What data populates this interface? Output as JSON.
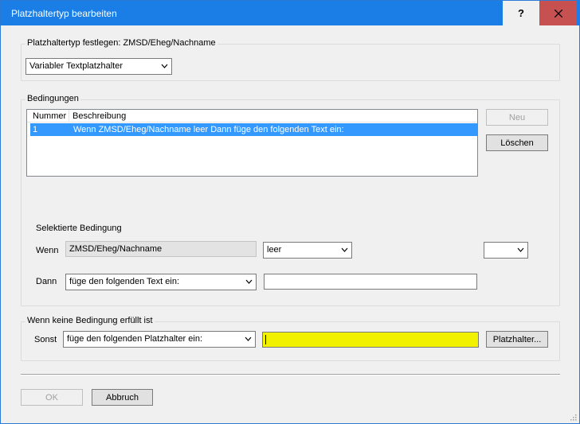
{
  "window": {
    "title": "Platzhaltertyp bearbeiten",
    "help_label": "?"
  },
  "type_group": {
    "label": "Platzhaltertyp festlegen: ZMSD/Eheg/Nachname",
    "type_select": "Variabler Textplatzhalter"
  },
  "conditions_group": {
    "label": "Bedingungen",
    "columns": [
      "Nummer",
      "Beschreibung"
    ],
    "rows": [
      {
        "number": "1",
        "description": "Wenn ZMSD/Eheg/Nachname leer Dann füge den folgenden Text ein:"
      }
    ],
    "new_button": "Neu",
    "delete_button": "Löschen",
    "selected_label": "Selektierte Bedingung",
    "if_label": "Wenn",
    "if_field": "ZMSD/Eheg/Nachname",
    "if_operator": "leer",
    "if_value": "",
    "then_label": "Dann",
    "then_action": "füge den folgenden Text ein:",
    "then_text": ""
  },
  "else_group": {
    "label": "Wenn keine Bedingung erfüllt ist",
    "else_label": "Sonst",
    "else_action": "füge den folgenden Platzhalter ein:",
    "else_value": "",
    "placeholder_button": "Platzhalter..."
  },
  "footer": {
    "ok_button": "OK",
    "cancel_button": "Abbruch"
  },
  "colors": {
    "titlebar": "#1a7ee6",
    "selection": "#3399ff",
    "highlight_field": "#f2f200",
    "close_button": "#c75050"
  }
}
